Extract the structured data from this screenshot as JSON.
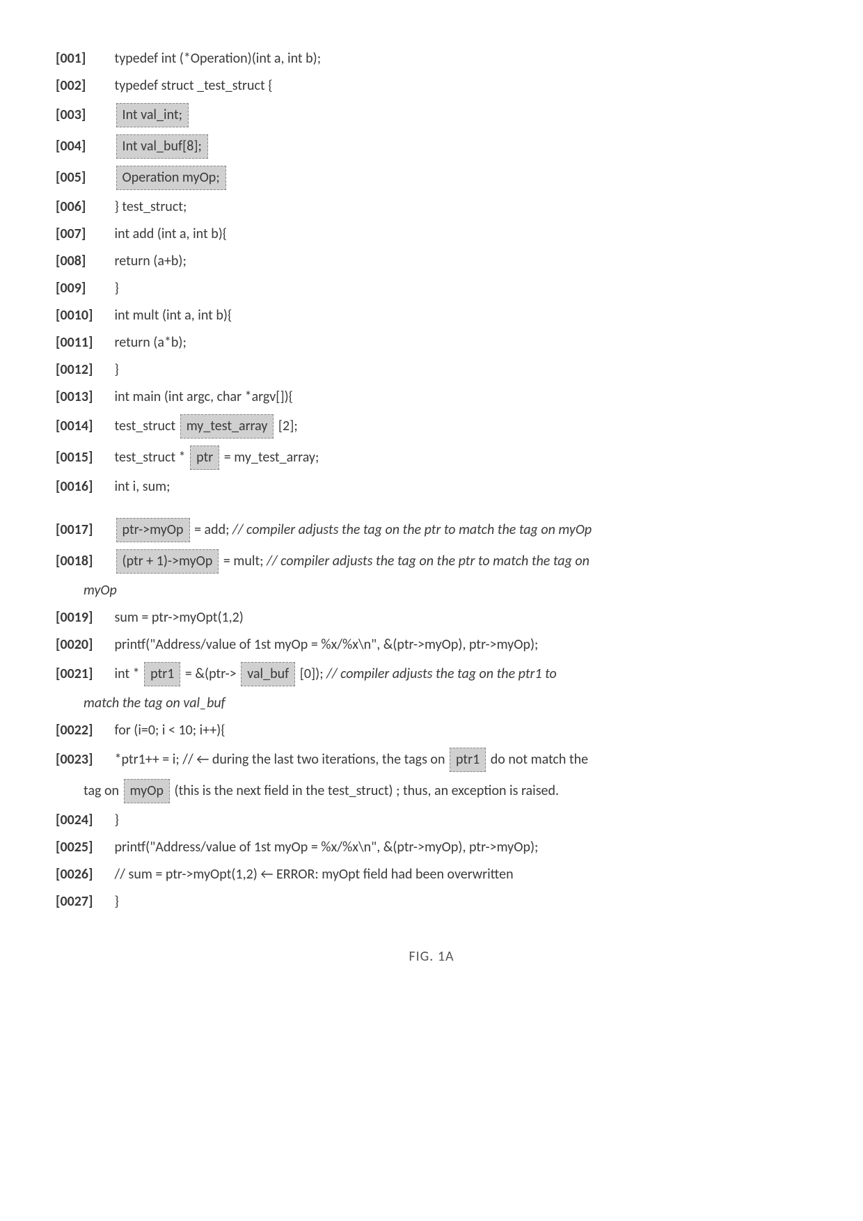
{
  "lines": {
    "l001": {
      "num": "[001]",
      "text": "typedef int (*Operation)(int a, int b);"
    },
    "l002": {
      "num": "[002]",
      "text": "typedef struct _test_struct {"
    },
    "l003": {
      "num": "[003]",
      "hl": "Int val_int;"
    },
    "l004": {
      "num": "[004]",
      "hl": "Int val_buf[8];"
    },
    "l005": {
      "num": "[005]",
      "hl": "Operation myOp;"
    },
    "l006": {
      "num": "[006]",
      "text": "} test_struct;"
    },
    "l007": {
      "num": "[007]",
      "text": "int add (int a, int b){"
    },
    "l008": {
      "num": "[008]",
      "text": "return (a+b);"
    },
    "l009": {
      "num": "[009]",
      "text": "}"
    },
    "l010": {
      "num": "[0010]",
      "text": "int mult (int a, int b){"
    },
    "l011": {
      "num": "[0011]",
      "text": "return (a*b);"
    },
    "l012": {
      "num": "[0012]",
      "text": "}"
    },
    "l013": {
      "num": "[0013]",
      "text": "int main (int argc, char *argv[]){"
    },
    "l014": {
      "num": "[0014]",
      "pre": "test_struct ",
      "hl": "my_test_array",
      "post": " [2];"
    },
    "l015": {
      "num": "[0015]",
      "pre": "test_struct * ",
      "hl": "ptr",
      "post": " = my_test_array;"
    },
    "l016": {
      "num": "[0016]",
      "text": "int i, sum;"
    },
    "l017": {
      "num": "[0017]",
      "hl": "ptr->myOp",
      "post": " = add; ",
      "comment": "// compiler adjusts the tag on the ptr to match the tag on myOp"
    },
    "l018": {
      "num": "[0018]",
      "hl": "(ptr + 1)->myOp",
      "post": "  = mult;  ",
      "comment": "// compiler adjusts the tag on the ptr to match the tag on"
    },
    "l018c": "myOp",
    "l019": {
      "num": "[0019]",
      "text": "sum = ptr->myOpt(1,2)"
    },
    "l020": {
      "num": "[0020]",
      "text": "printf(\"Address/value of 1st myOp = %x/%x\\n\", &(ptr->myOp), ptr->myOp);"
    },
    "l021": {
      "num": "[0021]",
      "pre": "int * ",
      "hl1": "ptr1",
      "mid": " = &(ptr-> ",
      "hl2": "val_buf",
      "post": " [0]); ",
      "comment": "// compiler adjusts the tag on the ptr1 to"
    },
    "l021c": "match the tag on val_buf",
    "l022": {
      "num": "[0022]",
      "text": "for (i=0; i < 10; i++){"
    },
    "l023": {
      "num": "[0023]",
      "pre": "*ptr1++ = i; // ← during the last two iterations, the tags on ",
      "hl": "ptr1",
      "post": " do not match the"
    },
    "l023c": {
      "pre": "tag on ",
      "hl": "myOp",
      "post": " (this is the next field in the test_struct) ; thus, an exception is raised."
    },
    "l024": {
      "num": "[0024]",
      "text": "}"
    },
    "l025": {
      "num": "[0025]",
      "text": "printf(\"Address/value of 1st myOp = %x/%x\\n\", &(ptr->myOp), ptr->myOp);"
    },
    "l026": {
      "num": "[0026]",
      "text": "// sum = ptr->myOpt(1,2) ← ERROR: myOpt field had been overwritten"
    },
    "l027": {
      "num": "[0027]",
      "text": "}"
    }
  },
  "figcaption": "FIG. 1A"
}
